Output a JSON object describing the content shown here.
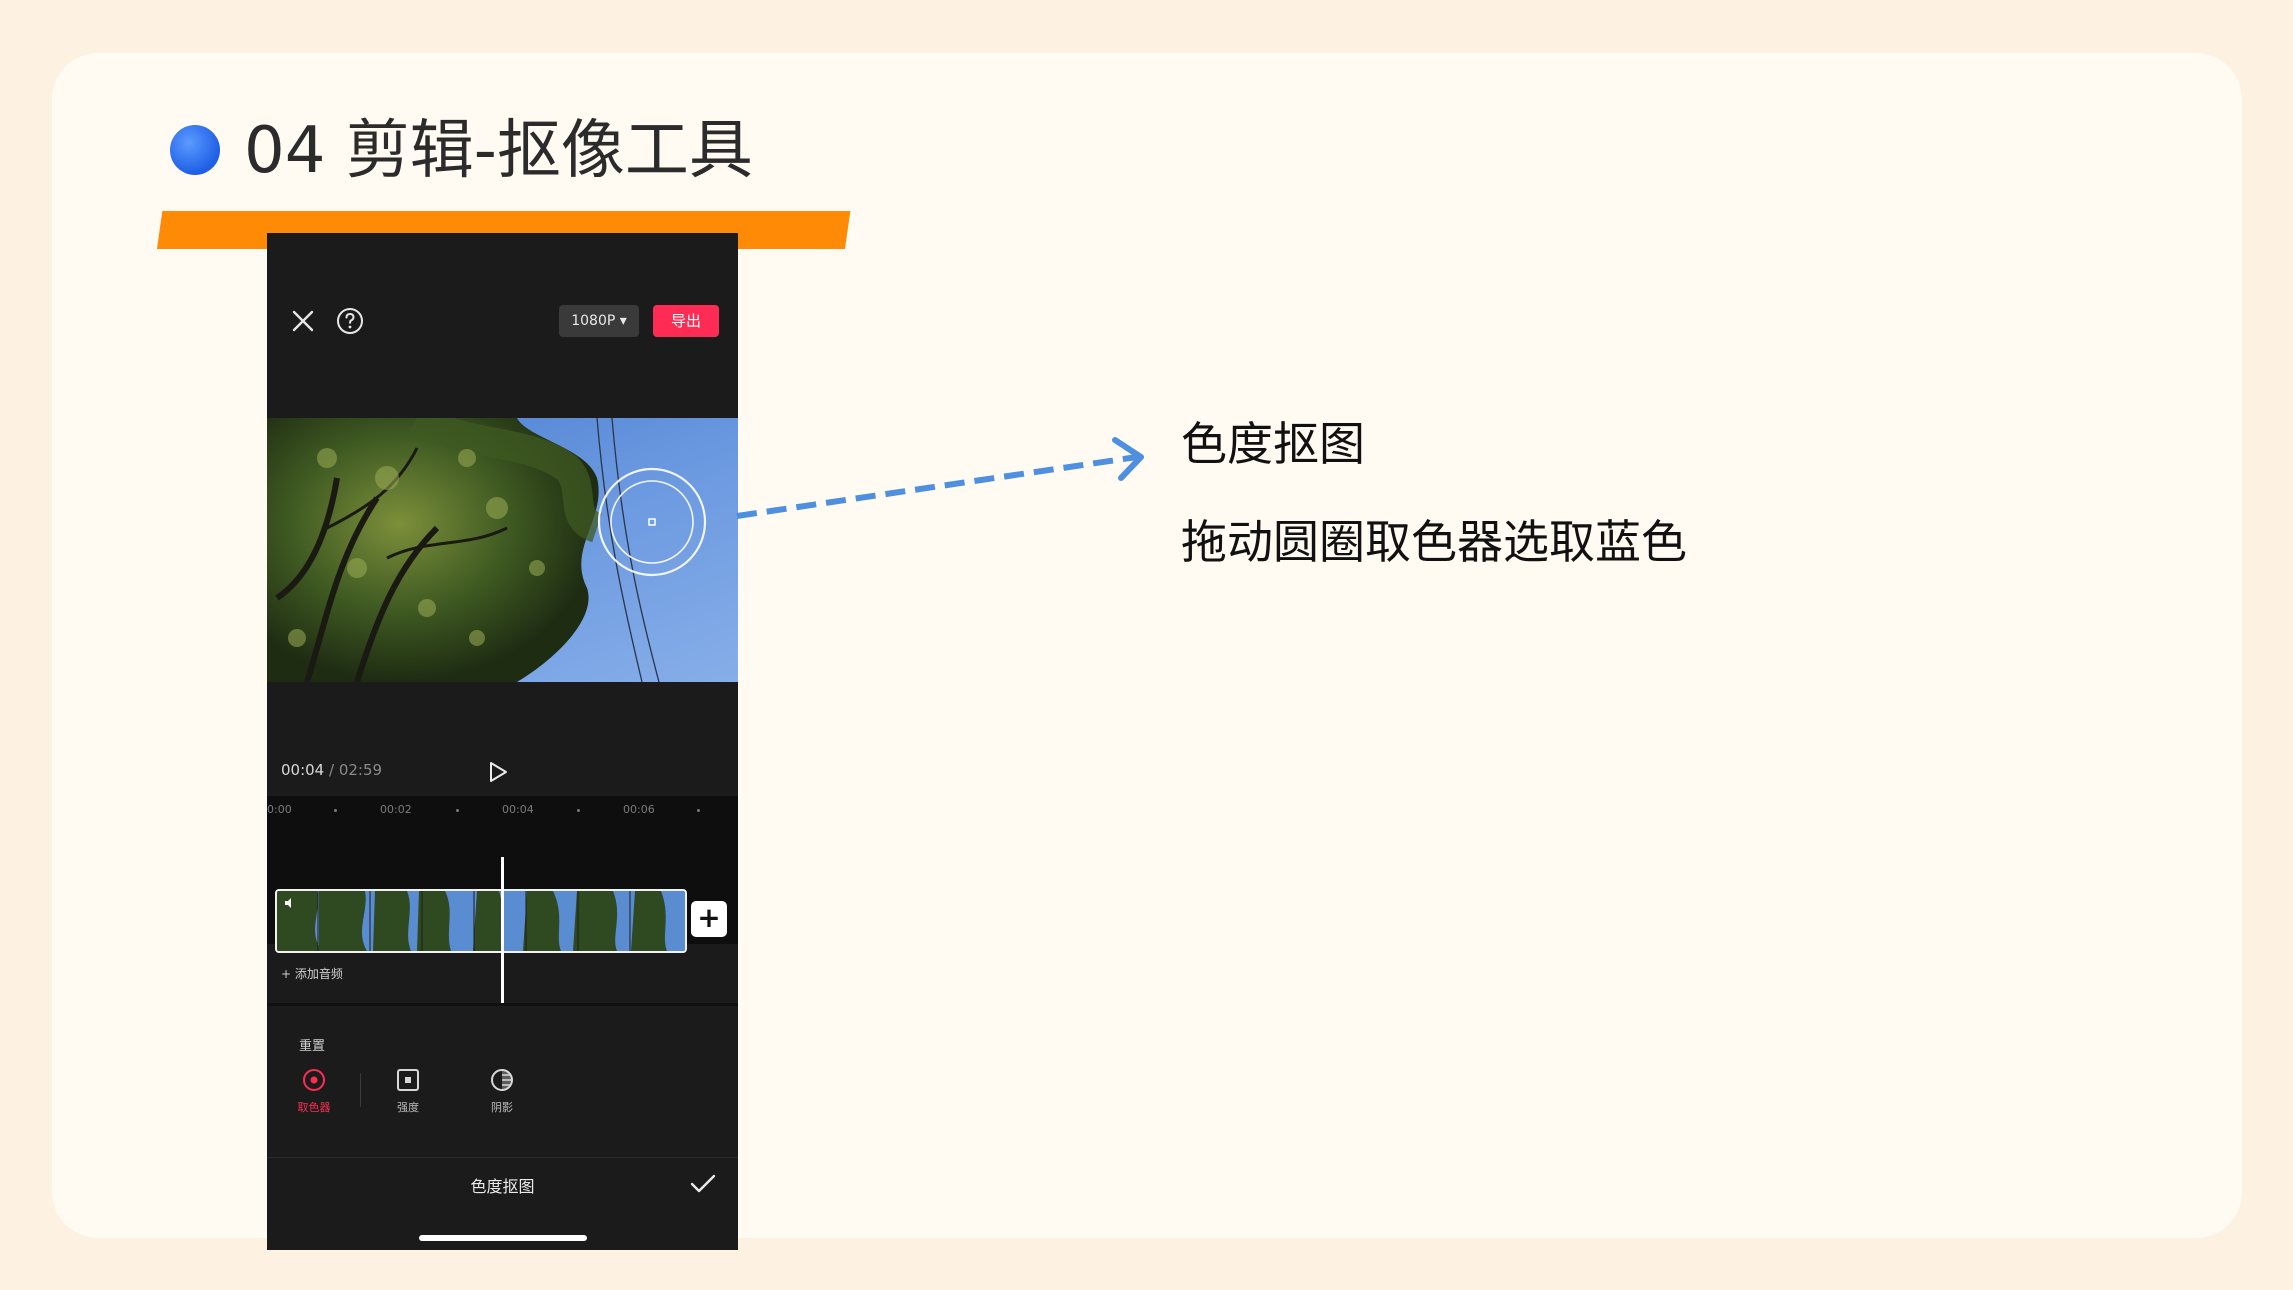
{
  "slide": {
    "title": "04 剪辑-抠像工具",
    "accent_color": "#ff8a05",
    "dot_color": "#2d6ff2"
  },
  "phone": {
    "resolution_label": "1080P ▾",
    "export_label": "导出",
    "current_time": "00:04",
    "time_separator": " / ",
    "total_time": "02:59",
    "ruler_ticks": [
      "0:00",
      "00:02",
      "00:04",
      "00:06"
    ],
    "add_audio_label": "+ 添加音频",
    "reset_label": "重置",
    "tools": [
      {
        "label": "取色器",
        "icon": "color-picker-icon",
        "active": true
      },
      {
        "label": "强度",
        "icon": "intensity-icon",
        "active": false
      },
      {
        "label": "阴影",
        "icon": "shadow-icon",
        "active": false
      }
    ],
    "panel_title": "色度抠图"
  },
  "annotations": {
    "line1": "色度抠图",
    "line2": "拖动圆圈取色器选取蓝色"
  }
}
